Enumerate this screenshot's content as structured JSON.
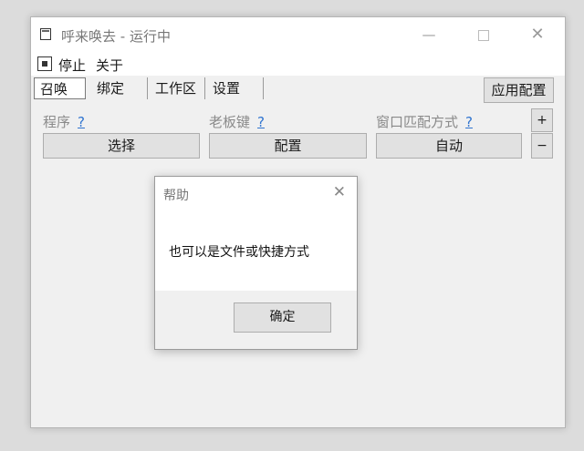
{
  "window": {
    "title": "呼来唤去 - 运行中",
    "controls": {
      "minimize": "—",
      "close": "✕"
    }
  },
  "menu": {
    "items": [
      "停止",
      "关于"
    ]
  },
  "tabs": [
    {
      "label": "召唤",
      "active": true
    },
    {
      "label": "绑定",
      "active": false
    },
    {
      "label": "工作区",
      "active": false
    },
    {
      "label": "设置",
      "active": false
    }
  ],
  "apply_button": "应用配置",
  "fields": [
    {
      "label": "程序",
      "help": "?",
      "button": "选择"
    },
    {
      "label": "老板键",
      "help": "?",
      "button": "配置"
    },
    {
      "label": "窗口匹配方式",
      "help": "?",
      "button": "自动"
    }
  ],
  "side_buttons": {
    "add": "+",
    "remove": "−"
  },
  "dialog": {
    "title": "帮助",
    "close": "✕",
    "message": "也可以是文件或快捷方式",
    "ok": "确定"
  }
}
